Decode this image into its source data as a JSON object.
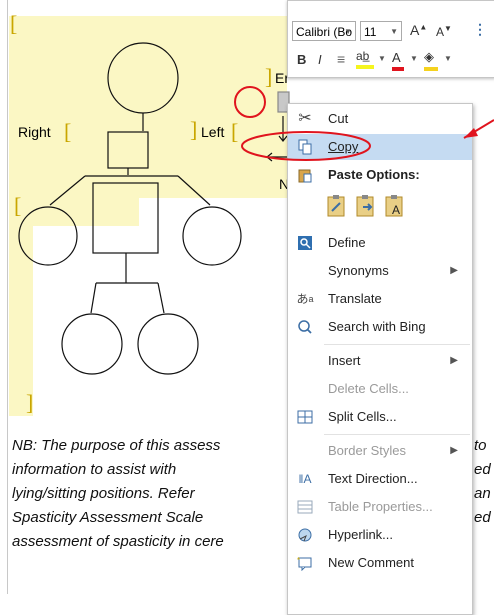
{
  "document": {
    "labels": {
      "right": "Right",
      "left": "Left",
      "er": "Er",
      "n": "N"
    },
    "bracket_char": "[",
    "bracket_close_char": "]",
    "nb_lines": [
      "NB: The purpose of this assess",
      "information  to  assist  with",
      "lying/sitting positions.  Refer",
      "Spasticity  Assessment  Scale",
      "assessment of spasticity in cere"
    ],
    "nb_right_fragments": [
      "to",
      "ed",
      "an",
      "ed"
    ]
  },
  "toolbar": {
    "font_name": "Calibri (Bo",
    "font_size": "11",
    "grow_font": "A",
    "shrink_font": "A",
    "bold": "B",
    "italic": "I"
  },
  "context_menu": {
    "items": [
      {
        "label": "Cut",
        "icon": "scissors-icon",
        "state": "enabled"
      },
      {
        "label": "Copy",
        "icon": "copy-icon",
        "state": "highlighted"
      },
      {
        "label": "Paste Options:",
        "icon": "clipboard-icon",
        "state": "header"
      },
      {
        "label": "Define",
        "icon": "define-icon",
        "state": "enabled"
      },
      {
        "label": "Synonyms",
        "icon": "",
        "state": "enabled",
        "submenu": true
      },
      {
        "label": "Translate",
        "icon": "translate-icon",
        "state": "enabled"
      },
      {
        "label": "Search with Bing",
        "icon": "search-icon",
        "state": "enabled"
      },
      {
        "label": "Insert",
        "icon": "",
        "state": "enabled",
        "submenu": true
      },
      {
        "label": "Delete Cells...",
        "icon": "",
        "state": "disabled"
      },
      {
        "label": "Split Cells...",
        "icon": "split-cells-icon",
        "state": "enabled"
      },
      {
        "label": "Border Styles",
        "icon": "",
        "state": "disabled",
        "submenu": true
      },
      {
        "label": "Text Direction...",
        "icon": "text-direction-icon",
        "state": "enabled"
      },
      {
        "label": "Table Properties...",
        "icon": "table-properties-icon",
        "state": "disabled"
      },
      {
        "label": "Hyperlink...",
        "icon": "hyperlink-icon",
        "state": "enabled"
      },
      {
        "label": "New Comment",
        "icon": "comment-icon",
        "state": "enabled"
      }
    ]
  },
  "colors": {
    "highlight": "#fbf7c4",
    "bracket": "#c9a600",
    "annotation_red": "#e0141e",
    "menu_hover": "#c5dbf2"
  }
}
